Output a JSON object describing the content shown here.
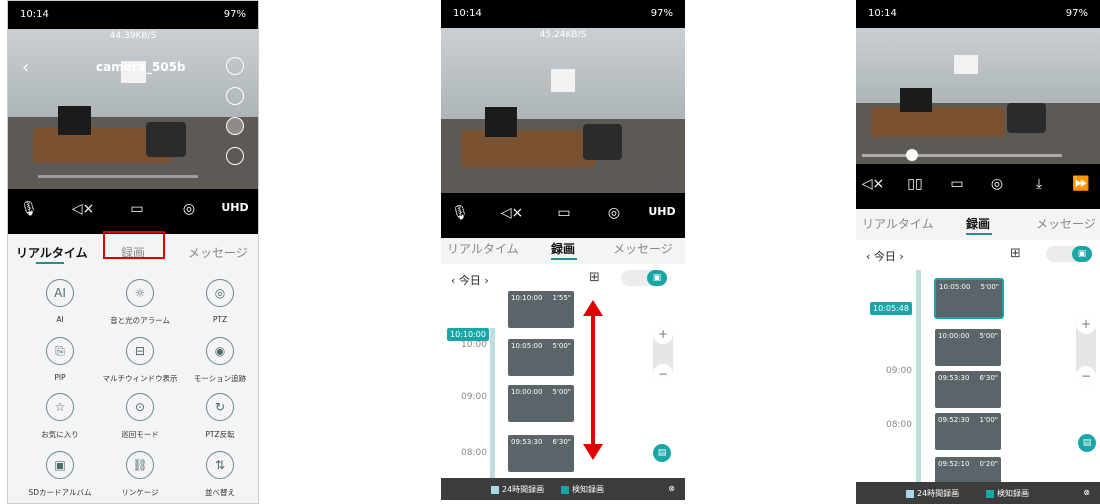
{
  "status": {
    "time": "10:14",
    "battery": "97%"
  },
  "phone1": {
    "rate": "44.39KB/S",
    "camera": "camera_505b",
    "controls": [
      "mic-icon",
      "mute-icon",
      "record-icon",
      "snapshot-icon",
      "UHD"
    ],
    "tabs": [
      "リアルタイム",
      "録画",
      "メッセージ"
    ],
    "grid": [
      {
        "icon": "AI",
        "label": "AI"
      },
      {
        "icon": "☼",
        "label": "音と光のアラーム"
      },
      {
        "icon": "◎",
        "label": "PTZ"
      },
      {
        "icon": "⎘",
        "label": "PIP"
      },
      {
        "icon": "⊟",
        "label": "マルチウィンドウ表示"
      },
      {
        "icon": "◉",
        "label": "モーション追跡"
      },
      {
        "icon": "☆",
        "label": "お気に入り"
      },
      {
        "icon": "⊙",
        "label": "巡回モード"
      },
      {
        "icon": "↻",
        "label": "PTZ反転"
      },
      {
        "icon": "▣",
        "label": "SDカードアルバム"
      },
      {
        "icon": "⛓",
        "label": "リンケージ"
      },
      {
        "icon": "⇅",
        "label": "並べ替え"
      }
    ]
  },
  "phone2": {
    "rate": "45.24KB/S",
    "controls": [
      "mic-icon",
      "mute-icon",
      "record-icon",
      "snapshot-icon",
      "UHD"
    ],
    "tabs": [
      "リアルタイム",
      "録画",
      "メッセージ"
    ],
    "date": "今日",
    "now": "10:10:00",
    "labels": [
      "10:00",
      "09:00",
      "08:00"
    ],
    "clips": [
      {
        "time": "10:10:00",
        "dur": "1'55\""
      },
      {
        "time": "10:05:00",
        "dur": "5'00\""
      },
      {
        "time": "10:00:00",
        "dur": "5'00\""
      },
      {
        "time": "09:53:30",
        "dur": "6'30\""
      }
    ],
    "legend": [
      "24時間録画",
      "検知録画"
    ]
  },
  "phone3": {
    "controls": [
      "mute-icon",
      "pause-icon",
      "record-icon",
      "snapshot-icon",
      "download-icon",
      "speed-icon"
    ],
    "tabs": [
      "リアルタイム",
      "録画",
      "メッセージ"
    ],
    "date": "今日",
    "now": "10:05:48",
    "labels": [
      "09:00",
      "08:00"
    ],
    "clips": [
      {
        "time": "10:05:00",
        "dur": "5'00\""
      },
      {
        "time": "10:00:00",
        "dur": "5'00\""
      },
      {
        "time": "09:53:30",
        "dur": "6'30\""
      },
      {
        "time": "09:52:30",
        "dur": "1'00\""
      },
      {
        "time": "09:52:10",
        "dur": "0'20\""
      }
    ],
    "legend": [
      "24時間録画",
      "検知録画"
    ]
  },
  "colors": {
    "accent": "#1aa6a6",
    "highlight": "#e00000"
  }
}
